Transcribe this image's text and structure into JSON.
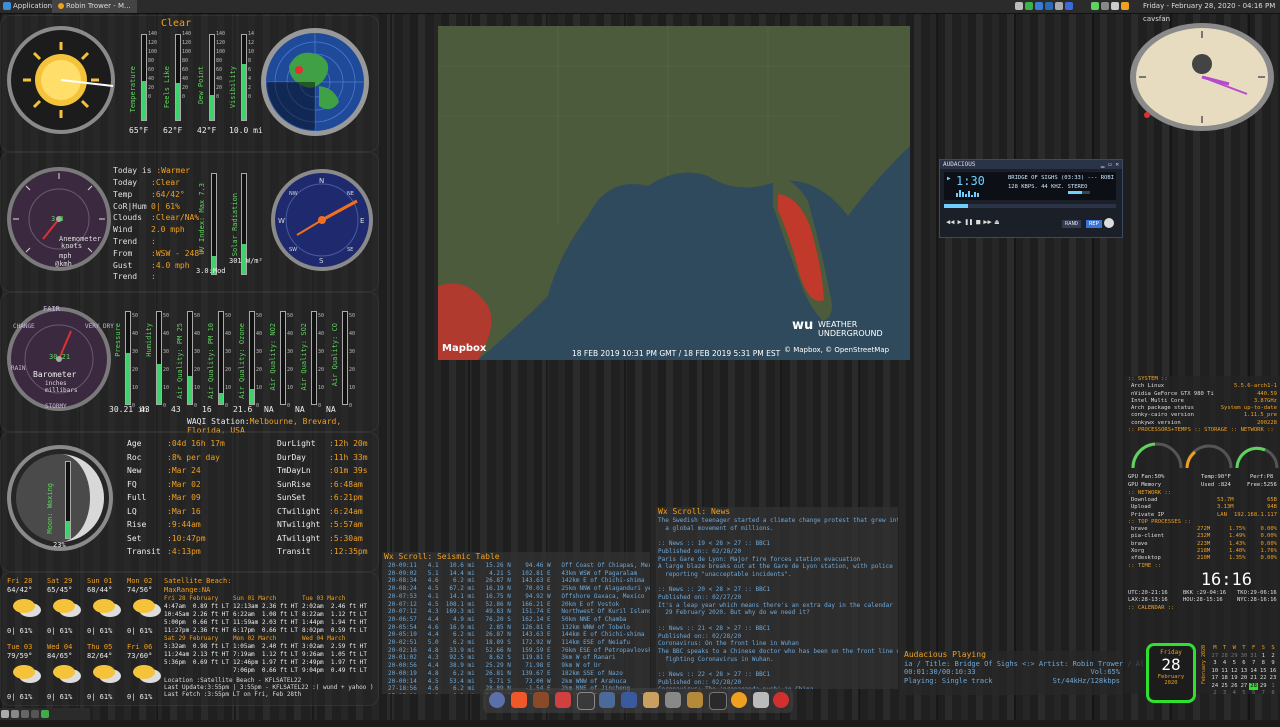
{
  "top_panel": {
    "applications": "Applications",
    "window_title": "Robin Trower - M...",
    "clock": "Friday - February 28, 2020 - 04:16 PM cavsfan"
  },
  "weather": {
    "condition": "Clear",
    "bars": [
      {
        "label": "Temperature",
        "value": "65°F",
        "level": 0.46
      },
      {
        "label": "Feels Like",
        "value": "62°F",
        "level": 0.44
      },
      {
        "label": "Dew Point",
        "value": "42°F",
        "level": 0.3
      },
      {
        "label": "Visibility",
        "value": "10.0 mi",
        "level": 0.66
      }
    ],
    "scale": [
      "140",
      "120",
      "100",
      "80",
      "60",
      "40",
      "20",
      "0"
    ],
    "vis_scale": [
      "14",
      "12",
      "10",
      "8",
      "6",
      "4",
      "2",
      "0"
    ]
  },
  "wind": {
    "today_is": "Today is ",
    "today_is_val": ":Warmer",
    "rows": [
      {
        "k": "Today",
        "v": ":Clear"
      },
      {
        "k": "Temp",
        "v": ":64/42°"
      },
      {
        "k": "CoR|Hum",
        "v": "0| 61%"
      },
      {
        "k": "Clouds",
        "v": ":Clear/NA%"
      },
      {
        "k": "Wind",
        "v": "2.0 mph"
      },
      {
        "k": "Trend",
        "v": ":"
      },
      {
        "k": "From",
        "v": ":WSW - 248°"
      },
      {
        "k": "Gust",
        "v": ":4.0 mph"
      },
      {
        "k": "Trend",
        "v": ":"
      }
    ],
    "anemometer_label": "Anemometer",
    "knots": "knots",
    "mph": "mph",
    "kmh": "@kmh",
    "speed": "3.8",
    "uv_label": "UV Index: Max 7.3",
    "uv_value": "3.0:Mod",
    "solar_label": "Solar Radiation",
    "solar_value": "301 W/m²",
    "compass": {
      "N": "N",
      "S": "S",
      "E": "E",
      "W": "W",
      "NE": "NE",
      "NW": "NW",
      "SE": "SE",
      "SW": "SW"
    }
  },
  "barometer": {
    "label": "Barometer",
    "units": "inches\nmillibars",
    "value": "30.21",
    "ring": [
      "FAIR",
      "CHANGE",
      "VERY DRY",
      "RAIN",
      "STORMY"
    ],
    "bars": [
      {
        "label": "Pressure",
        "value": "30.21 in",
        "level": 0.55
      },
      {
        "label": "Humidity",
        "value": "43",
        "level": 0.43
      },
      {
        "label": "Air Quality: PM 25",
        "value": "43",
        "level": 0.3
      },
      {
        "label": "Air Quality: PM 10",
        "value": "16",
        "level": 0.12
      },
      {
        "label": "Air Quality: Ozone",
        "value": "21.6",
        "level": 0.16
      },
      {
        "label": "Air Quality: NO2",
        "value": "NA",
        "level": 0
      },
      {
        "label": "Air Quality: SO2",
        "value": "NA",
        "level": 0
      },
      {
        "label": "Air Quality: CO",
        "value": "NA",
        "level": 0
      }
    ],
    "scale": [
      "50",
      "40",
      "30",
      "20",
      "10",
      "0"
    ],
    "waqi": "WAQI Station:",
    "waqi_val": "Melbourne, Brevard, Florida, USA"
  },
  "moon": {
    "phase_label": "Moon: Waxing",
    "illum": "23%",
    "left": [
      {
        "k": "Age",
        "v": ":04d 16h 17m"
      },
      {
        "k": "Roc",
        "v": ":8% per day"
      },
      {
        "k": "New",
        "v": ":Mar 24"
      },
      {
        "k": "FQ",
        "v": ":Mar 02"
      },
      {
        "k": "Full",
        "v": ":Mar 09"
      },
      {
        "k": "LQ",
        "v": ":Mar 16"
      },
      {
        "k": "Rise",
        "v": ":9:44am"
      },
      {
        "k": "Set",
        "v": ":10:47pm"
      },
      {
        "k": "Transit",
        "v": ":4:13pm"
      }
    ],
    "right": [
      {
        "k": "DurLight",
        "v": ":12h 20m"
      },
      {
        "k": "DurDay",
        "v": ":11h 33m"
      },
      {
        "k": "TmDayLn",
        "v": ":01m 39s"
      },
      {
        "k": "SunRise",
        "v": ":6:48am"
      },
      {
        "k": "SunSet",
        "v": ":6:21pm"
      },
      {
        "k": "CTwilight",
        "v": ":6:24am"
      },
      {
        "k": "NTwilight",
        "v": ":5:57am"
      },
      {
        "k": "ATwilight",
        "v": ":5:30am"
      },
      {
        "k": "Transit",
        "v": ":12:35pm"
      }
    ]
  },
  "forecast": [
    {
      "day": "Fri 28",
      "temp": "64/42°",
      "pop": "0| 61%"
    },
    {
      "day": "Sat 29",
      "temp": "65/45°",
      "pop": "0| 61%"
    },
    {
      "day": "Sun 01",
      "temp": "68/44°",
      "pop": "0| 61%"
    },
    {
      "day": "Mon 02",
      "temp": "74/56°",
      "pop": "0| 61%"
    },
    {
      "day": "Tue 03",
      "temp": "79/59°",
      "pop": "0| 61%"
    },
    {
      "day": "Wed 04",
      "temp": "84/65°",
      "pop": "0| 61%"
    },
    {
      "day": "Thu 05",
      "temp": "82/64°",
      "pop": "0| 61%"
    },
    {
      "day": "Fri 06",
      "temp": "73/60°",
      "pop": "0| 61%"
    }
  ],
  "tides": {
    "station": "Satellite Beach:",
    "maxrange": "MaxRange:NA",
    "col1": [
      "Fri 28 February",
      "4:47am  0.89 ft LT",
      "10:45am 2.26 ft HT",
      "5:00pm  0.66 ft LT",
      "11:27pm 2.36 ft HT",
      "Sat 29 February",
      "5:32am  0.98 ft LT",
      "11:24am 2.13 ft HT",
      "5:36pm  0.69 ft LT"
    ],
    "col2": [
      "Sun 01 March",
      "12:13am 2.36 ft HT",
      "6:22am  1.08 ft LT",
      "11:59am 2.03 ft HT",
      "6:17pm  0.66 ft LT",
      "Mon 02 March",
      "1:05am  2.40 ft HT",
      "7:19am  1.12 ft LT",
      "12:46pm 1.97 ft HT",
      "7:06pm  0.66 ft LT"
    ],
    "col3": [
      "Tue 03 March",
      "2:02am  2.46 ft HT",
      "8:22am  1.12 ft LT",
      "1:44pm  1.94 ft HT",
      "8:02pm  0.59 ft LT",
      "Wed 04 March",
      "3:02am  2.59 ft HT",
      "9:26am  1.05 ft LT",
      "2:49pm  1.97 ft HT",
      "9:04pm  0.49 ft LT"
    ],
    "location": "Location     :Satellite Beach - KFLSATEL22",
    "last_update": "Last Update:3:55pm | 3:55pm - KFLSATEL22 :( wund + yahoo )",
    "last_fetch": "Last Fetch   :3:55pm LT on Fri, Feb 28th"
  },
  "map": {
    "timestamp": "18 FEB 2019 10:31 PM GMT / 18 FEB 2019 5:31 PM EST",
    "mapbox": "Mapbox",
    "brand": "WEATHER\nUNDERGROUND",
    "credit": "© Mapbox, © OpenStreetMap"
  },
  "seismic": {
    "title": "Wx Scroll: Seismic Table",
    "rows": [
      "20-09:11   4.1   10.6 mi   15.26 N    94.46 W   Off Coast Of Chiapas, Mexico",
      "20-09:02   5.1   14.4 mi    4.21 S   102.81 E   43km WSW of Pagaralam",
      "20-08:34   4.6    6.2 mi   26.87 N   143.63 E   142km E of Chichi-shima",
      "20-08:24   4.5   67.2 mi   16.19 N    70.03 E   25km NNW of Alaganduri ye Kiraz",
      "20-07:53   4.1   14.1 mi   16.75 N    94.92 W   Offshore Oaxaca, Mexico",
      "20-07:12   4.5  108.1 mi   52.86 N   166.21 E   20km E of Vostok",
      "20-07:12   4.3  169.3 mi   49.83 N   151.74 E   Northwest Of Kuril Islands",
      "20-06:57   4.4    4.9 mi   76.20 S   162.14 E   50km NNE of Chamba",
      "20-05:54   4.6   16.9 mi    2.85 N   126.81 E   132km WNW of Tobelo",
      "20-05:10   4.4    6.2 mi   26.87 N   143.63 E   144km E of Chichi-shima",
      "20-02:51   5.0    6.2 mi   18.89 S   172.92 W   114km ESE of Neiafu",
      "20-02:16   4.8   33.9 mi   52.66 N   159.59 E   76km ESE of Petropavlovsk-Kamchat",
      "20-01:02   4.3   92.5 mi    8.62 S   119.81 E   3km W of Ranari",
      "20-00:56   4.4   38.9 mi   25.29 N    71.98 E   9km W of Ur",
      "20-00:19   4.8    6.2 mi   26.81 N   139.67 E   182km SSE of Nazo",
      "20-00:14   4.5   53.4 mi    5.71 S    73.00 W   2km WNW of Arahuca",
      "27-18:56   4.6    6.2 mi   28.89 N    -1.54 E   2km NNE of Jincheng",
      "27-17:29   5.2    6.2 mi   54.09 S   118.78 W   Southern East Pacific Rise"
    ]
  },
  "news": {
    "title": "Wx Scroll: News",
    "lines": [
      "The Swedish teenager started a climate change protest that grew into",
      "  a global movement of millions.",
      "",
      ":: News :: 19 < 28 > 27 :: BBC1",
      "Published on:: 02/28/20",
      "Paris Gare de Lyon: Major fire forces station evacuation",
      "A large blaze breaks out at the Gare de Lyon station, with police",
      "  reporting \"unacceptable incidents\".",
      "",
      ":: News :: 20 < 28 > 27 :: BBC1",
      "Published on:: 02/27/20",
      "It's a leap year which means there's an extra day in the calendar",
      "  29 February 2020. But why do we need it?",
      "",
      ":: News :: 21 < 28 > 27 :: BBC1",
      "Published on:: 02/28/20",
      "Coronavirus: On the front line in Wuhan",
      "The BBC speaks to a Chinese doctor who has been on the front line of",
      "  fighting Coronavirus in Wuhan.",
      "",
      ":: News :: 22 < 28 > 27 :: BBC1",
      "Published on:: 02/28/20",
      "Coronavirus: The 'propaganda push' in China",
      "As China battles the deadly virus, medics on the front line are being",
      "  hailed as heroes."
    ]
  },
  "audacious": {
    "title": "AUDACIOUS",
    "time": "1:30",
    "track": "BRIDGE OF SIGHS (03:33) --- ROBI",
    "bitrate": "128",
    "kbps": "KBPS.",
    "khz": "44",
    "khz_label": "KHZ.",
    "stereo": "STEREO",
    "rand": "RAND",
    "rep": "REP"
  },
  "aud_status": {
    "title": "Audacious Playing",
    "track_line": "ia / Title: Bridge Of Sighs  <:> Artist: Robin Trower / Al",
    "time_line": "00:01:30/00:10:33",
    "vol": "Vol:65%",
    "playing": "Playing: Single track",
    "format": "St/44kHz/128kbps"
  },
  "system": {
    "header": ":: SYSTEM ::",
    "rows": [
      {
        "k": "Arch Linux",
        "v": "5.5.6-arch1-1"
      },
      {
        "k": "nVidia GeForce GTX 980 Ti",
        "v": "440.59"
      },
      {
        "k": "Intel Multi Core",
        "v": "3.87GHz"
      },
      {
        "k": "Arch package status",
        "v": "System up-to-date"
      },
      {
        "k": "conky-cairo version",
        "v": "1.11.5_pre"
      },
      {
        "k": "conkywx version",
        "v": "200228"
      }
    ],
    "header2": ":: PROCESSORS+TEMPS :: STORAGE :: NETWORK ::",
    "gpu_fan": "GPU  Fan:50%",
    "temp": "Temp:90°F",
    "perf": "Perf:P8",
    "gpu_mem": "GPU  Memory",
    "used": "Used :824",
    "free": "Free:5256",
    "net_header": ":: NETWORK ::",
    "net": [
      {
        "k": "Download",
        "a": "53.7M",
        "b": "65B"
      },
      {
        "k": "Upload",
        "a": "3.13M",
        "b": "94B"
      },
      {
        "k": "Private IP",
        "a": "LAN",
        "b": "192.168.1.117"
      }
    ],
    "proc_header": ":: TOP PROCESSES ::",
    "procs": [
      {
        "n": "brave",
        "m": "272M",
        "c": "1.75%",
        "d": "0.00%"
      },
      {
        "n": "pia-client",
        "m": "232M",
        "c": "1.49%",
        "d": "0.00%"
      },
      {
        "n": "brave",
        "m": "223M",
        "c": "1.43%",
        "d": "0.00%"
      },
      {
        "n": "Xorg",
        "m": "218M",
        "c": "1.40%",
        "d": "1.76%"
      },
      {
        "n": "xfdesktop",
        "m": "210M",
        "c": "1.35%",
        "d": "0.00%"
      }
    ],
    "time_header": ":: TIME ::",
    "big_time": "16:16",
    "zones": [
      [
        "UTC:20-21:16",
        "BKK :29-04:16",
        "TKO:29-06:16"
      ],
      [
        "LAX:28-13:16",
        "HOU:28-15:16",
        "NYC:28-16:16"
      ]
    ],
    "cal_header": ":: CALENDAR ::"
  },
  "calendar_tile": {
    "dow": "Friday",
    "day": "28",
    "month": "February",
    "year": "2020"
  },
  "mini_cal": {
    "head": [
      "M",
      "T",
      "W",
      "T",
      "F",
      "S",
      "S"
    ],
    "rows": [
      [
        "27",
        "28",
        "29",
        "30",
        "31",
        "1",
        "2"
      ],
      [
        "3",
        "4",
        "5",
        "6",
        "7",
        "8",
        "9"
      ],
      [
        "10",
        "11",
        "12",
        "13",
        "14",
        "15",
        "16"
      ],
      [
        "17",
        "18",
        "19",
        "20",
        "21",
        "22",
        "23"
      ],
      [
        "24",
        "25",
        "26",
        "27",
        "28",
        "29",
        "1"
      ],
      [
        "2",
        "3",
        "4",
        "5",
        "6",
        "7",
        "8"
      ]
    ],
    "side": "February 2020"
  }
}
